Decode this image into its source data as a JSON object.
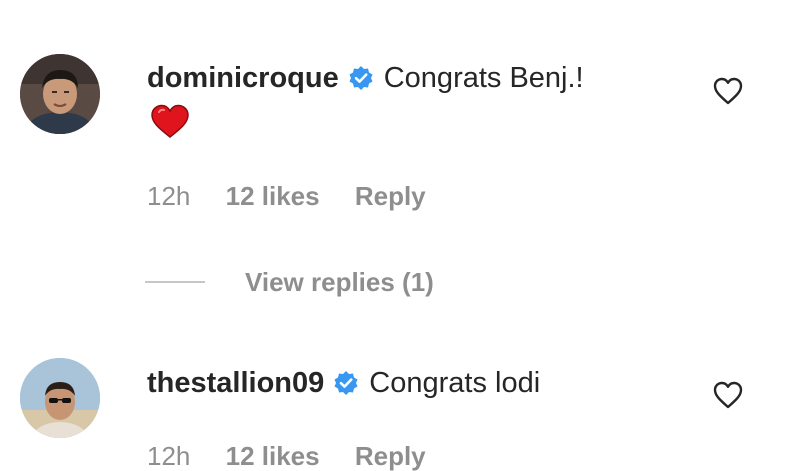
{
  "comments": [
    {
      "username": "dominicroque",
      "text": "Congrats Benj.!",
      "emoji": "red-heart-emoji",
      "time": "12h",
      "likes": "12 likes",
      "reply": "Reply",
      "view_replies": "View replies (1)"
    },
    {
      "username": "thestallion09",
      "text": "Congrats lodi",
      "time": "12h",
      "likes": "12 likes",
      "reply": "Reply"
    }
  ],
  "colors": {
    "verified": "#3897f0",
    "text": "#262626",
    "muted": "#8e8e8e",
    "emoji_heart": "#e0141c"
  },
  "icons": {
    "verified": "verified-badge-icon",
    "like": "heart-outline-icon"
  }
}
